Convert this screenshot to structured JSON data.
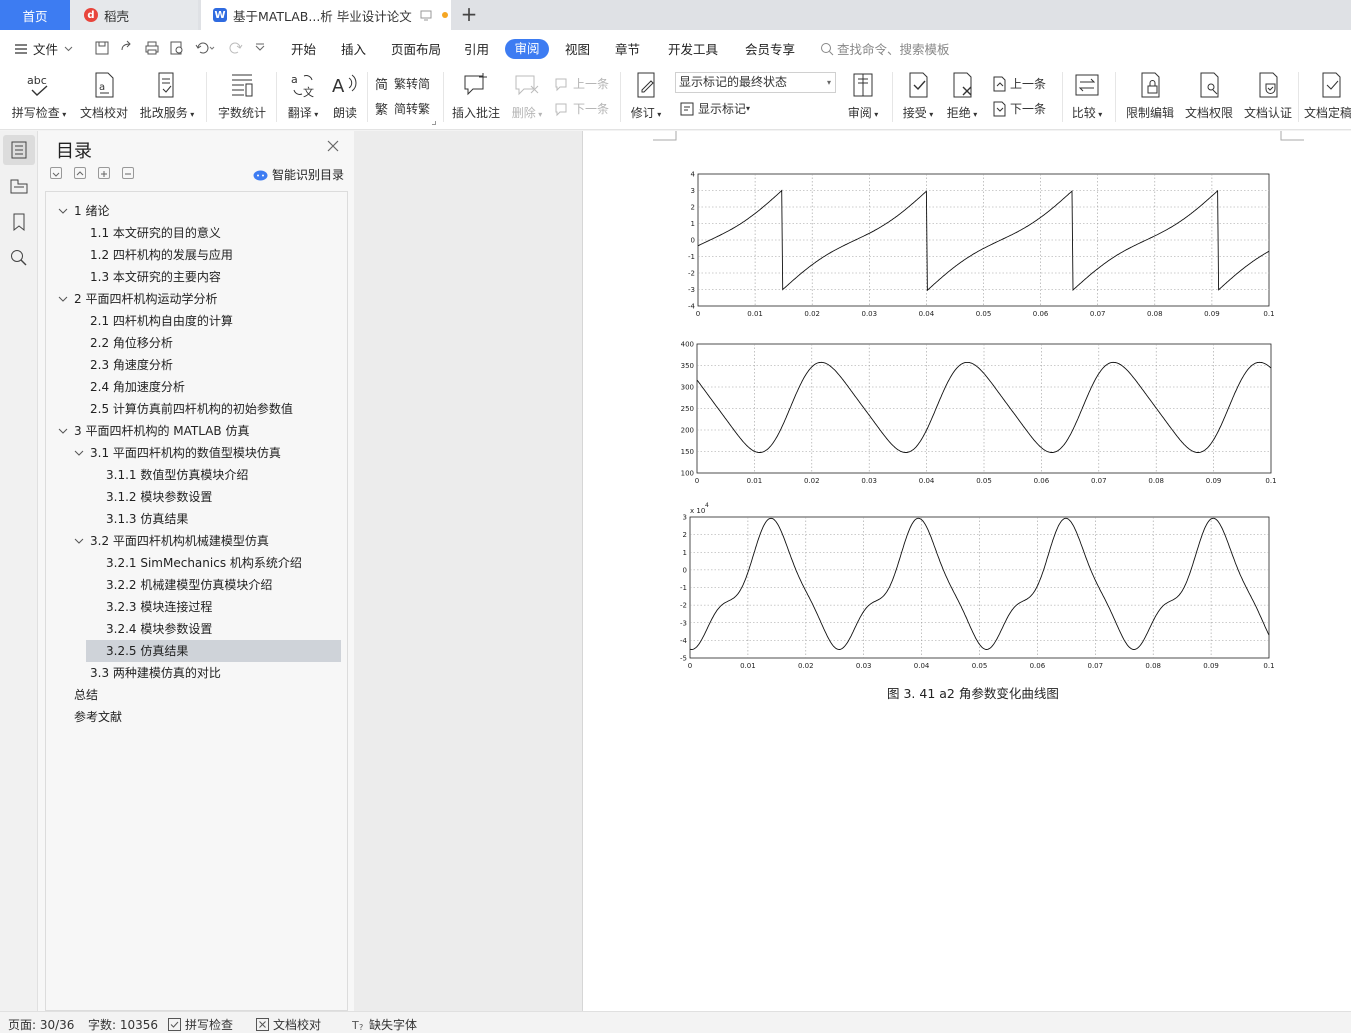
{
  "tabs": {
    "home": "首页",
    "daoke": "稻壳",
    "doc": "基于MATLAB...析 毕业设计论文"
  },
  "menu": {
    "file": "文件",
    "items": [
      "开始",
      "插入",
      "页面布局",
      "引用",
      "审阅",
      "视图",
      "章节",
      "开发工具",
      "会员专享"
    ],
    "active": "审阅",
    "search_placeholder": "查找命令、搜索模板"
  },
  "toolbar": {
    "spellcheck": "拼写检查",
    "doc_proof": "文档校对",
    "batch_service": "批改服务",
    "word_count": "字数统计",
    "translate": "翻译",
    "read_aloud": "朗读",
    "trad_to_simp": "繁转简",
    "simp_to_trad": "简转繁",
    "insert_comment": "插入批注",
    "delete": "删除",
    "prev_comment": "上一条",
    "next_comment": "下一条",
    "track_changes": "修订",
    "markup_state": "显示标记的最终状态",
    "show_markup": "显示标记",
    "review_pane": "审阅",
    "accept": "接受",
    "reject": "拒绝",
    "prev_change": "上一条",
    "next_change": "下一条",
    "compare": "比较",
    "restrict_edit": "限制编辑",
    "doc_permission": "文档权限",
    "doc_certify": "文档认证",
    "doc_final": "文档定稿"
  },
  "toc": {
    "title": "目录",
    "smart_label": "智能识别目录",
    "items": [
      {
        "text": "1  绪论",
        "level": 1,
        "expandable": true
      },
      {
        "text": "1.1  本文研究的目的意义",
        "level": 2
      },
      {
        "text": "1.2  四杆机构的发展与应用",
        "level": 2
      },
      {
        "text": "1.3  本文研究的主要内容",
        "level": 2
      },
      {
        "text": "2  平面四杆机构运动学分析",
        "level": 1,
        "expandable": true
      },
      {
        "text": "2.1  四杆机构自由度的计算",
        "level": 2
      },
      {
        "text": "2.2  角位移分析",
        "level": 2
      },
      {
        "text": "2.3  角速度分析",
        "level": 2
      },
      {
        "text": "2.4  角加速度分析",
        "level": 2
      },
      {
        "text": "2.5  计算仿真前四杆机构的初始参数值",
        "level": 2
      },
      {
        "text": "3  平面四杆机构的 MATLAB 仿真",
        "level": 1,
        "expandable": true
      },
      {
        "text": "3.1  平面四杆机构的数值型模块仿真",
        "level": 2,
        "expandable": true
      },
      {
        "text": "3.1.1  数值型仿真模块介绍",
        "level": 3
      },
      {
        "text": "3.1.2  模块参数设置",
        "level": 3
      },
      {
        "text": "3.1.3  仿真结果",
        "level": 3
      },
      {
        "text": "3.2  平面四杆机构机械建模型仿真",
        "level": 2,
        "expandable": true
      },
      {
        "text": "3.2.1 SimMechanics 机构系统介绍",
        "level": 3
      },
      {
        "text": "3.2.2  机械建模型仿真模块介绍",
        "level": 3
      },
      {
        "text": "3.2.3  模块连接过程",
        "level": 3
      },
      {
        "text": "3.2.4  模块参数设置",
        "level": 3
      },
      {
        "text": "3.2.5  仿真结果",
        "level": 3,
        "selected": true
      },
      {
        "text": "3.3  两种建模仿真的对比",
        "level": 2
      },
      {
        "text": "总结",
        "level": 0
      },
      {
        "text": "参考文献",
        "level": 0
      }
    ]
  },
  "figure": {
    "caption": "图 3. 41  a2 角参数变化曲线图",
    "x_ticks": [
      "0",
      "0.01",
      "0.02",
      "0.03",
      "0.04",
      "0.05",
      "0.06",
      "0.07",
      "0.08",
      "0.09",
      "0.1"
    ],
    "plot1_y_ticks": [
      "4",
      "3",
      "2",
      "1",
      "0",
      "-1",
      "-2",
      "-3",
      "-4"
    ],
    "plot2_y_ticks": [
      "400",
      "350",
      "300",
      "250",
      "200",
      "150",
      "100"
    ],
    "plot3_y_ticks": [
      "3",
      "2",
      "1",
      "0",
      "-1",
      "-2",
      "-3",
      "-4",
      "-5"
    ],
    "plot3_exponent": "x 10",
    "plot3_exponent_power": "4"
  },
  "status": {
    "page": "页面: 30/36",
    "words": "字数: 10356",
    "spellcheck": "拼写检查",
    "doc_proof": "文档校对",
    "missing_font": "缺失字体"
  },
  "colors": {
    "accent": "#3d7cf2",
    "selected_row": "#cfd3d9"
  }
}
